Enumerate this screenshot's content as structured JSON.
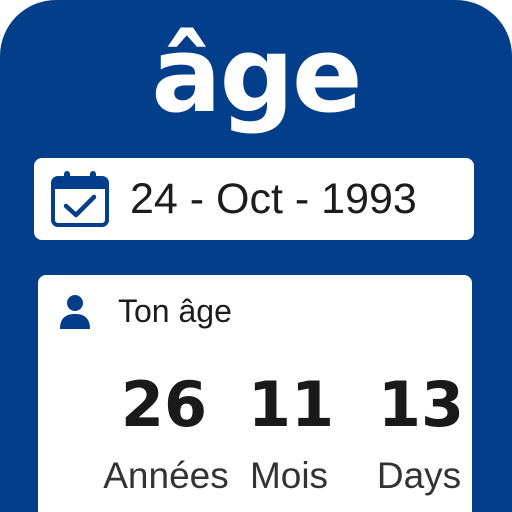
{
  "app": {
    "title": "âge",
    "brand_color": "#023e8a"
  },
  "birth_date": {
    "icon": "calendar-check-icon",
    "value": "24 - Oct - 1993"
  },
  "age": {
    "icon": "person-icon",
    "label": "Ton âge",
    "years": {
      "value": "26",
      "unit": "Années"
    },
    "months": {
      "value": "11",
      "unit": "Mois"
    },
    "days": {
      "value": "13",
      "unit": "Days"
    }
  }
}
